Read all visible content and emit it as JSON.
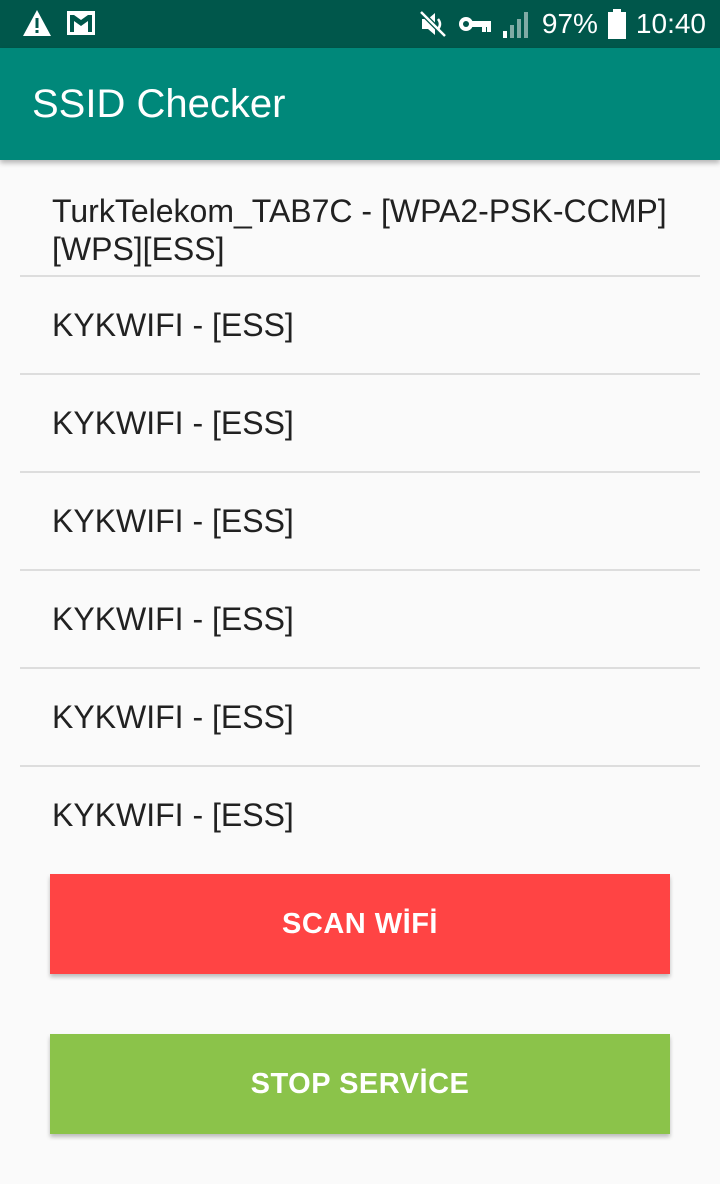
{
  "status_bar": {
    "battery_percent": "97%",
    "time": "10:40",
    "icons": [
      "warning-icon",
      "gmail-icon",
      "mute-icon",
      "vpn-key-icon",
      "signal-icon",
      "battery-icon"
    ]
  },
  "app_bar": {
    "title": "SSID Checker"
  },
  "wifi_list": [
    {
      "label": "TurkTelekom_TAB7C - [WPA2-PSK-CCMP][WPS][ESS]"
    },
    {
      "label": "KYKWIFI - [ESS]"
    },
    {
      "label": "KYKWIFI - [ESS]"
    },
    {
      "label": "KYKWIFI - [ESS]"
    },
    {
      "label": "KYKWIFI - [ESS]"
    },
    {
      "label": "KYKWIFI - [ESS]"
    },
    {
      "label": "KYKWIFI - [ESS]"
    }
  ],
  "buttons": {
    "scan_label": "SCAN WİFİ",
    "stop_label": "STOP SERVİCE"
  },
  "colors": {
    "status_bar": "#00574b",
    "app_bar": "#00887a",
    "scan_button": "#ff4444",
    "stop_button": "#8bc34a",
    "background": "#fafafa"
  }
}
